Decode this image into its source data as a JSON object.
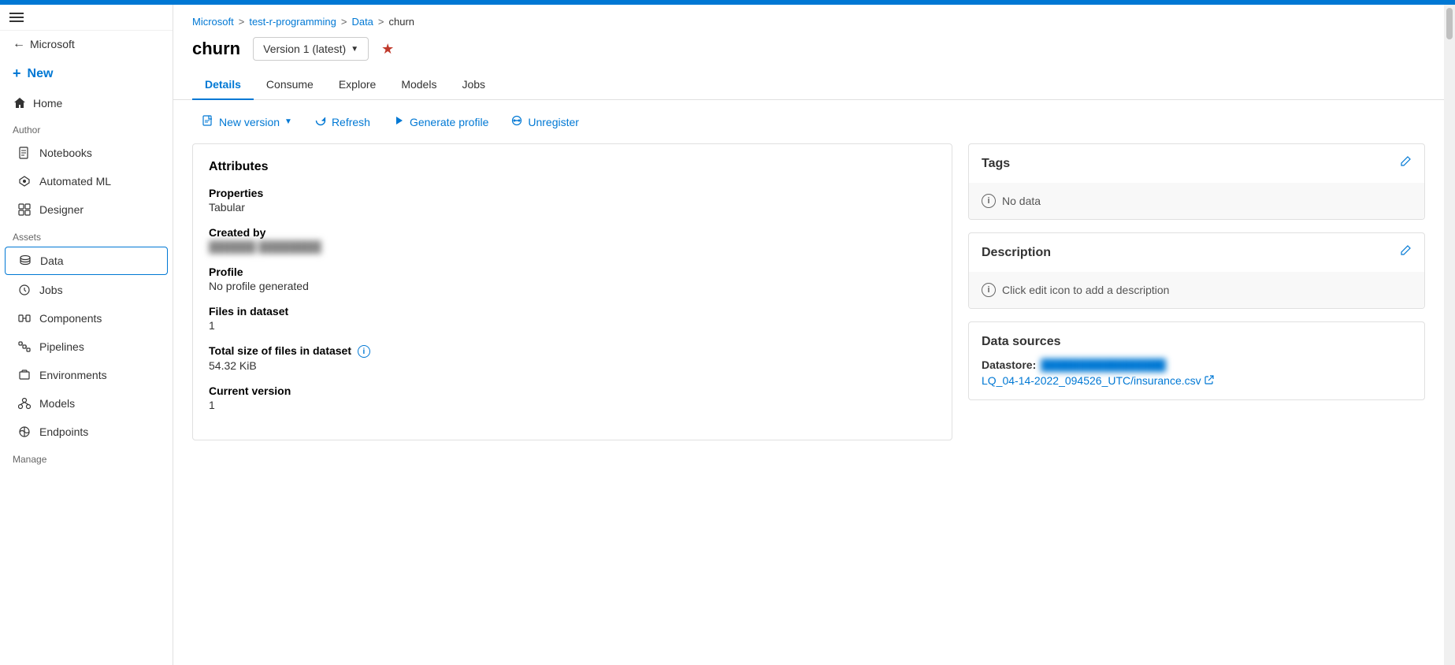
{
  "topbar": {
    "color": "#0078d4"
  },
  "sidebar": {
    "back_label": "Microsoft",
    "new_label": "New",
    "home_label": "Home",
    "author_section": "Author",
    "assets_section": "Assets",
    "manage_section": "Manage",
    "items_author": [
      {
        "id": "notebooks",
        "label": "Notebooks",
        "icon": "notebooks-icon"
      },
      {
        "id": "automated-ml",
        "label": "Automated ML",
        "icon": "automl-icon"
      },
      {
        "id": "designer",
        "label": "Designer",
        "icon": "designer-icon"
      }
    ],
    "items_assets": [
      {
        "id": "data",
        "label": "Data",
        "icon": "data-icon",
        "active": true
      },
      {
        "id": "jobs",
        "label": "Jobs",
        "icon": "jobs-icon"
      },
      {
        "id": "components",
        "label": "Components",
        "icon": "components-icon"
      },
      {
        "id": "pipelines",
        "label": "Pipelines",
        "icon": "pipelines-icon"
      },
      {
        "id": "environments",
        "label": "Environments",
        "icon": "environments-icon"
      },
      {
        "id": "models",
        "label": "Models",
        "icon": "models-icon"
      },
      {
        "id": "endpoints",
        "label": "Endpoints",
        "icon": "endpoints-icon"
      }
    ]
  },
  "breadcrumb": {
    "items": [
      {
        "label": "Microsoft",
        "link": true
      },
      {
        "label": "test-r-programming",
        "link": true
      },
      {
        "label": "Data",
        "link": true
      },
      {
        "label": "churn",
        "link": false
      }
    ]
  },
  "page": {
    "title": "churn",
    "version_label": "Version 1 (latest)",
    "tabs": [
      {
        "id": "details",
        "label": "Details",
        "active": true
      },
      {
        "id": "consume",
        "label": "Consume"
      },
      {
        "id": "explore",
        "label": "Explore"
      },
      {
        "id": "models",
        "label": "Models"
      },
      {
        "id": "jobs",
        "label": "Jobs"
      }
    ],
    "toolbar": {
      "new_version_label": "New version",
      "refresh_label": "Refresh",
      "generate_profile_label": "Generate profile",
      "unregister_label": "Unregister"
    },
    "attributes": {
      "section_title": "Attributes",
      "properties_label": "Properties",
      "properties_value": "Tabular",
      "created_by_label": "Created by",
      "created_by_value": "██████ ████████",
      "profile_label": "Profile",
      "profile_value": "No profile generated",
      "files_in_dataset_label": "Files in dataset",
      "files_in_dataset_value": "1",
      "total_size_label": "Total size of files in dataset",
      "total_size_value": "54.32 KiB",
      "current_version_label": "Current version",
      "current_version_value": "1"
    },
    "tags": {
      "title": "Tags",
      "no_data": "No data"
    },
    "description": {
      "title": "Description",
      "placeholder": "Click edit icon to add a description"
    },
    "data_sources": {
      "title": "Data sources",
      "datastore_label": "Datastore:",
      "datastore_value": "████████████████",
      "file_path": "LQ_04-14-2022_094526_UTC/insurance.csv"
    }
  }
}
